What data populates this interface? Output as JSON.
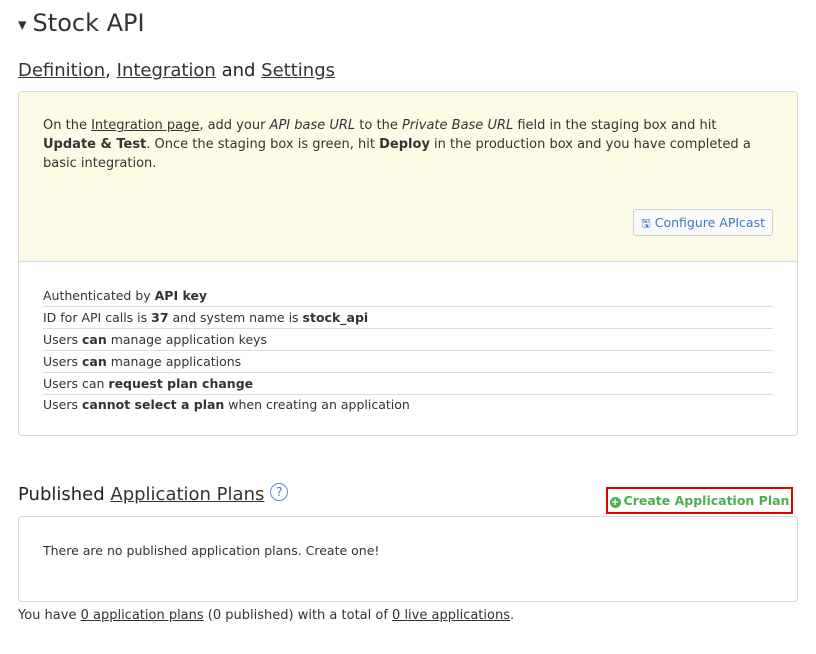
{
  "header": {
    "toggle_glyph": "▾",
    "title": "Stock API"
  },
  "subnav": {
    "definition": "Definition",
    "sep1": ",",
    "integration": "Integration",
    "and": "and",
    "settings": "Settings"
  },
  "notice": {
    "t1": "On the ",
    "integration_link": "Integration page",
    "t2": ", add your ",
    "api_base_url": "API base URL",
    "t3": " to the ",
    "private_base_url": "Private Base URL",
    "t4": " field in the staging box and hit ",
    "update_test": "Update & Test",
    "t5": ". Once the staging box is green, hit ",
    "deploy": "Deploy",
    "t6": " in the production box and you have completed a basic integration.",
    "configure_icon": "🖫",
    "configure_label": "Configure APIcast"
  },
  "facts": {
    "auth_prefix": "Authenticated by ",
    "auth_value": "API key",
    "id_prefix": "ID for API calls is ",
    "id_value": "37",
    "id_mid": " and system name is ",
    "system_name": "stock_api",
    "keys_prefix": "Users ",
    "keys_value": "can",
    "keys_suffix": " manage application keys",
    "apps_prefix": "Users ",
    "apps_value": "can",
    "apps_suffix": " manage applications",
    "plan_change_prefix": "Users can ",
    "plan_change_value": "request plan change",
    "select_prefix": "Users ",
    "select_value": "cannot select a plan",
    "select_suffix": " when creating an application"
  },
  "plans": {
    "heading_prefix": "Published ",
    "heading_link": "Application Plans",
    "help_glyph": "?",
    "create_plus": "+",
    "create_label": "Create Application Plan",
    "empty_text": "There are no published application plans. Create one!"
  },
  "summary": {
    "t1": "You have ",
    "plans_link": "0 application plans",
    "t2": " (0 published) with a total of ",
    "live_link": "0 live applications",
    "t3": "."
  },
  "colors": {
    "notice_bg": "#fcfce6",
    "link_blue": "#3f78c6",
    "create_green": "#4caf50",
    "highlight_red": "#e00000"
  }
}
